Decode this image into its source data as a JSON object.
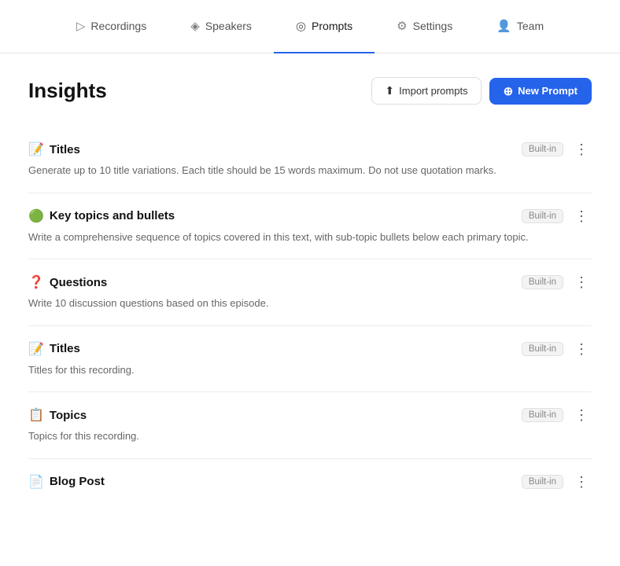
{
  "nav": {
    "items": [
      {
        "id": "recordings",
        "label": "Recordings",
        "icon": "▷",
        "active": false
      },
      {
        "id": "speakers",
        "label": "Speakers",
        "icon": "◈",
        "active": false
      },
      {
        "id": "prompts",
        "label": "Prompts",
        "icon": "◎",
        "active": true
      },
      {
        "id": "settings",
        "label": "Settings",
        "icon": "⚙",
        "active": false
      },
      {
        "id": "team",
        "label": "Team",
        "icon": "👤",
        "active": false
      }
    ]
  },
  "header": {
    "title": "Insights",
    "import_label": "Import prompts",
    "new_prompt_label": "New Prompt"
  },
  "prompts": [
    {
      "id": "titles-1",
      "emoji": "📝",
      "name": "Titles",
      "description": "Generate up to 10 title variations. Each title should be 15 words maximum. Do not use quotation marks.",
      "badge": "Built-in"
    },
    {
      "id": "key-topics",
      "emoji": "🟢",
      "name": "Key topics and bullets",
      "description": "Write a comprehensive sequence of topics covered in this text, with sub-topic bullets below each primary topic.",
      "badge": "Built-in"
    },
    {
      "id": "questions",
      "emoji": "❓",
      "name": "Questions",
      "description": "Write 10 discussion questions based on this episode.",
      "badge": "Built-in"
    },
    {
      "id": "titles-2",
      "emoji": "📝",
      "name": "Titles",
      "description": "Titles for this recording.",
      "badge": "Built-in"
    },
    {
      "id": "topics",
      "emoji": "📋",
      "name": "Topics",
      "description": "Topics for this recording.",
      "badge": "Built-in"
    },
    {
      "id": "blog-post",
      "emoji": "📄",
      "name": "Blog Post",
      "description": "",
      "badge": "Built-in"
    }
  ]
}
